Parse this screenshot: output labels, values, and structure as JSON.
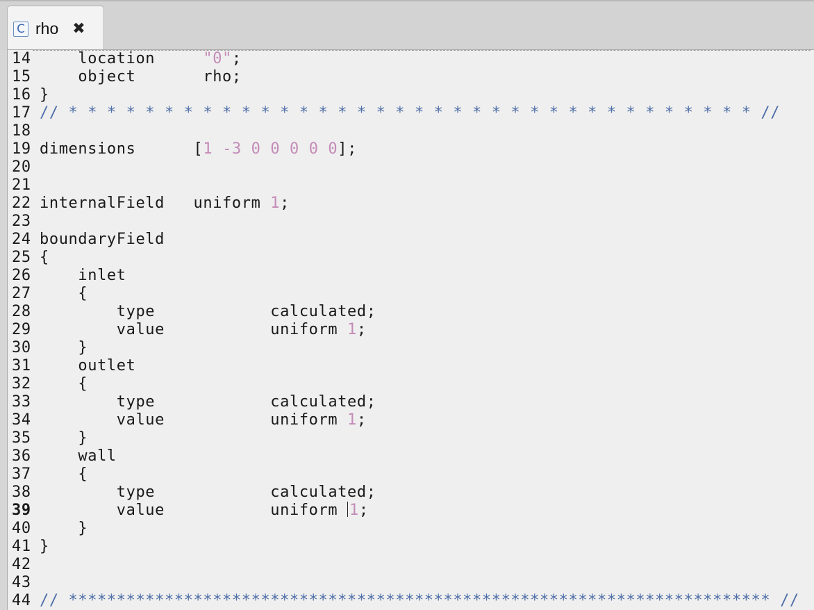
{
  "tab": {
    "icon": "c-file-icon",
    "icon_glyph": "C",
    "title": "rho",
    "close_glyph": "✖"
  },
  "lines": [
    {
      "n": "14",
      "parts": [
        [
          "",
          "    location     "
        ],
        [
          "str",
          "\"0\""
        ],
        [
          "",
          ";"
        ]
      ]
    },
    {
      "n": "15",
      "parts": [
        [
          "",
          "    object       rho;"
        ]
      ]
    },
    {
      "n": "16",
      "parts": [
        [
          "",
          "}"
        ]
      ]
    },
    {
      "n": "17",
      "parts": [
        [
          "cmt",
          "// * * * * * * * * * * * * * * * * * * * * * * * * * * * * * * * * * * * * //"
        ]
      ]
    },
    {
      "n": "18",
      "parts": []
    },
    {
      "n": "19",
      "parts": [
        [
          "",
          "dimensions      ["
        ],
        [
          "num",
          "1"
        ],
        [
          "",
          " "
        ],
        [
          "num",
          "-3"
        ],
        [
          "",
          " "
        ],
        [
          "num",
          "0 0 0 0 0"
        ],
        [
          "",
          "];"
        ]
      ]
    },
    {
      "n": "20",
      "parts": []
    },
    {
      "n": "21",
      "parts": []
    },
    {
      "n": "22",
      "parts": [
        [
          "",
          "internalField   uniform "
        ],
        [
          "num",
          "1"
        ],
        [
          "",
          ";"
        ]
      ]
    },
    {
      "n": "23",
      "parts": []
    },
    {
      "n": "24",
      "parts": [
        [
          "",
          "boundaryField"
        ]
      ]
    },
    {
      "n": "25",
      "parts": [
        [
          "",
          "{"
        ]
      ]
    },
    {
      "n": "26",
      "parts": [
        [
          "",
          "    inlet"
        ]
      ]
    },
    {
      "n": "27",
      "parts": [
        [
          "",
          "    {"
        ]
      ]
    },
    {
      "n": "28",
      "parts": [
        [
          "",
          "        type            calculated;"
        ]
      ]
    },
    {
      "n": "29",
      "parts": [
        [
          "",
          "        value           uniform "
        ],
        [
          "num",
          "1"
        ],
        [
          "",
          ";"
        ]
      ]
    },
    {
      "n": "30",
      "parts": [
        [
          "",
          "    }"
        ]
      ]
    },
    {
      "n": "31",
      "parts": [
        [
          "",
          "    outlet"
        ]
      ]
    },
    {
      "n": "32",
      "parts": [
        [
          "",
          "    {"
        ]
      ]
    },
    {
      "n": "33",
      "parts": [
        [
          "",
          "        type            calculated;"
        ]
      ]
    },
    {
      "n": "34",
      "parts": [
        [
          "",
          "        value           uniform "
        ],
        [
          "num",
          "1"
        ],
        [
          "",
          ";"
        ]
      ]
    },
    {
      "n": "35",
      "parts": [
        [
          "",
          "    }"
        ]
      ]
    },
    {
      "n": "36",
      "parts": [
        [
          "",
          "    wall"
        ]
      ]
    },
    {
      "n": "37",
      "parts": [
        [
          "",
          "    {"
        ]
      ]
    },
    {
      "n": "38",
      "parts": [
        [
          "",
          "        type            calculated;"
        ]
      ]
    },
    {
      "n": "39",
      "current": true,
      "parts": [
        [
          "",
          "        value           uniform "
        ],
        [
          "caret",
          ""
        ],
        [
          "num",
          "1"
        ],
        [
          "",
          ";"
        ]
      ]
    },
    {
      "n": "40",
      "parts": [
        [
          "",
          "    }"
        ]
      ]
    },
    {
      "n": "41",
      "parts": [
        [
          "",
          "}"
        ]
      ]
    },
    {
      "n": "42",
      "parts": []
    },
    {
      "n": "43",
      "parts": []
    },
    {
      "n": "44",
      "parts": [
        [
          "cmt",
          "// ************************************************************************* //"
        ]
      ]
    }
  ],
  "colors": {
    "string": "#c48bb8",
    "number": "#c48bb8",
    "comment": "#4f6fa8",
    "text": "#1a1a1a",
    "editor_bg": "#efefef"
  }
}
